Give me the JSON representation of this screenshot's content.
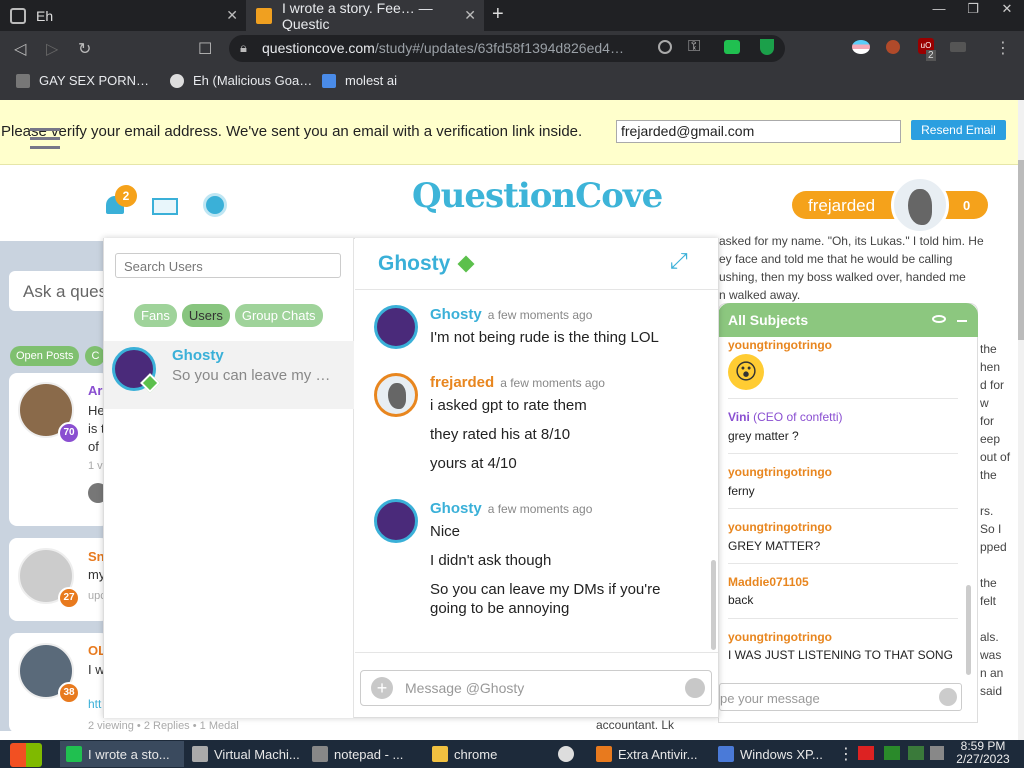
{
  "browser": {
    "tabs": [
      {
        "title": "Eh",
        "close": "✕"
      },
      {
        "title": "I wrote a story. Fee… — Questic",
        "close": "✕"
      }
    ],
    "new_tab": "+",
    "url_host": "questioncove.com",
    "url_path": "/study#/updates/63fd58f1394d826ed4…",
    "bookmarks": [
      "GAY SEX PORN…",
      "Eh (Malicious Goa…",
      "molest ai"
    ],
    "ext_badge": "2"
  },
  "verify_bar": {
    "message": "Please verify your email address. We've sent you an email with a verification link inside.",
    "email": "frejarded@gmail.com",
    "button": "Resend Email"
  },
  "header": {
    "logo": "QuestionCove",
    "notif_count": "2",
    "username": "frejarded",
    "score": "0"
  },
  "left_feed": {
    "ask_placeholder": "Ask a question",
    "pills": [
      "Open Posts",
      "C"
    ],
    "cards": [
      {
        "name": "Ari",
        "lines": [
          "He",
          "is t",
          "of"
        ],
        "meta": "1 v",
        "badge": "70",
        "badge_color": "#8a4fd1"
      },
      {
        "name": "Sn",
        "lines": [
          "my"
        ],
        "meta": "upc",
        "badge": "27",
        "badge_color": "#e87a1e"
      },
      {
        "name": "OL",
        "lines": [
          "I w"
        ],
        "meta": "htt",
        "badge": "38",
        "badge_color": "#e87a1e"
      }
    ],
    "footer": "2 viewing • 2 Replies • 1 Medal"
  },
  "chat": {
    "search_placeholder": "Search Users",
    "tabs": [
      "Fans",
      "Users",
      "Group Chats"
    ],
    "active_tab": "Users",
    "conversation": {
      "name": "Ghosty",
      "preview": "So you can leave my …"
    },
    "header_name": "Ghosty",
    "messages": [
      {
        "sender": "Ghosty",
        "time": "a few moments ago",
        "lines": [
          "I'm not being rude is the thing LOL"
        ]
      },
      {
        "sender": "frejarded",
        "time": "a few moments ago",
        "lines": [
          "i asked gpt to rate them",
          "they rated his at 8/10",
          "yours at 4/10"
        ]
      },
      {
        "sender": "Ghosty",
        "time": "a few moments ago",
        "lines": [
          "Nice",
          "I didn't ask though",
          "So you can leave my DMs if you're",
          "going to be annoying"
        ]
      }
    ],
    "composer_placeholder": "Message @Ghosty"
  },
  "right_feed": {
    "snippets": [
      "asked for my name. \"Oh, its Lukas.\" I told him. He",
      "ey face and told me that he would be calling",
      "ushing, then my boss walked over, handed me",
      "n walked away."
    ],
    "side_bits": [
      "the",
      "hen",
      "d for",
      "w",
      "for",
      "eep",
      "out of",
      "the",
      "rs.",
      "So I",
      "pped",
      "the",
      "felt",
      "als.",
      "was",
      "n an",
      "said"
    ],
    "bottom_text": "accountant. Lk",
    "subjects_panel": {
      "title": "All Subjects",
      "messages": [
        {
          "sender": "youngtringotringo",
          "text": "😮"
        },
        {
          "sender": "Vini",
          "role": "(CEO of confetti)",
          "text": "grey matter ?"
        },
        {
          "sender": "youngtringotringo",
          "text": "ferny"
        },
        {
          "sender": "youngtringotringo",
          "text": "GREY MATTER?"
        },
        {
          "sender": "Maddie071105",
          "text": "back"
        },
        {
          "sender": "youngtringotringo",
          "text": "I WAS JUST LISTENING TO THAT SONG"
        }
      ],
      "composer_placeholder": "pe your message"
    }
  },
  "taskbar": {
    "items": [
      "I wrote a sto...",
      "Virtual Machi...",
      "notepad - ...",
      "chrome",
      "",
      "Extra Antivir...",
      "Windows XP..."
    ],
    "time": "8:59 PM",
    "date": "2/27/2023"
  },
  "colors": {
    "brand_blue": "#3db4d8",
    "ghosty_blue": "#3ab0d8",
    "frejarded_orange": "#e8861f",
    "green": "#8cc77f",
    "score_orange": "#f5a21b"
  }
}
